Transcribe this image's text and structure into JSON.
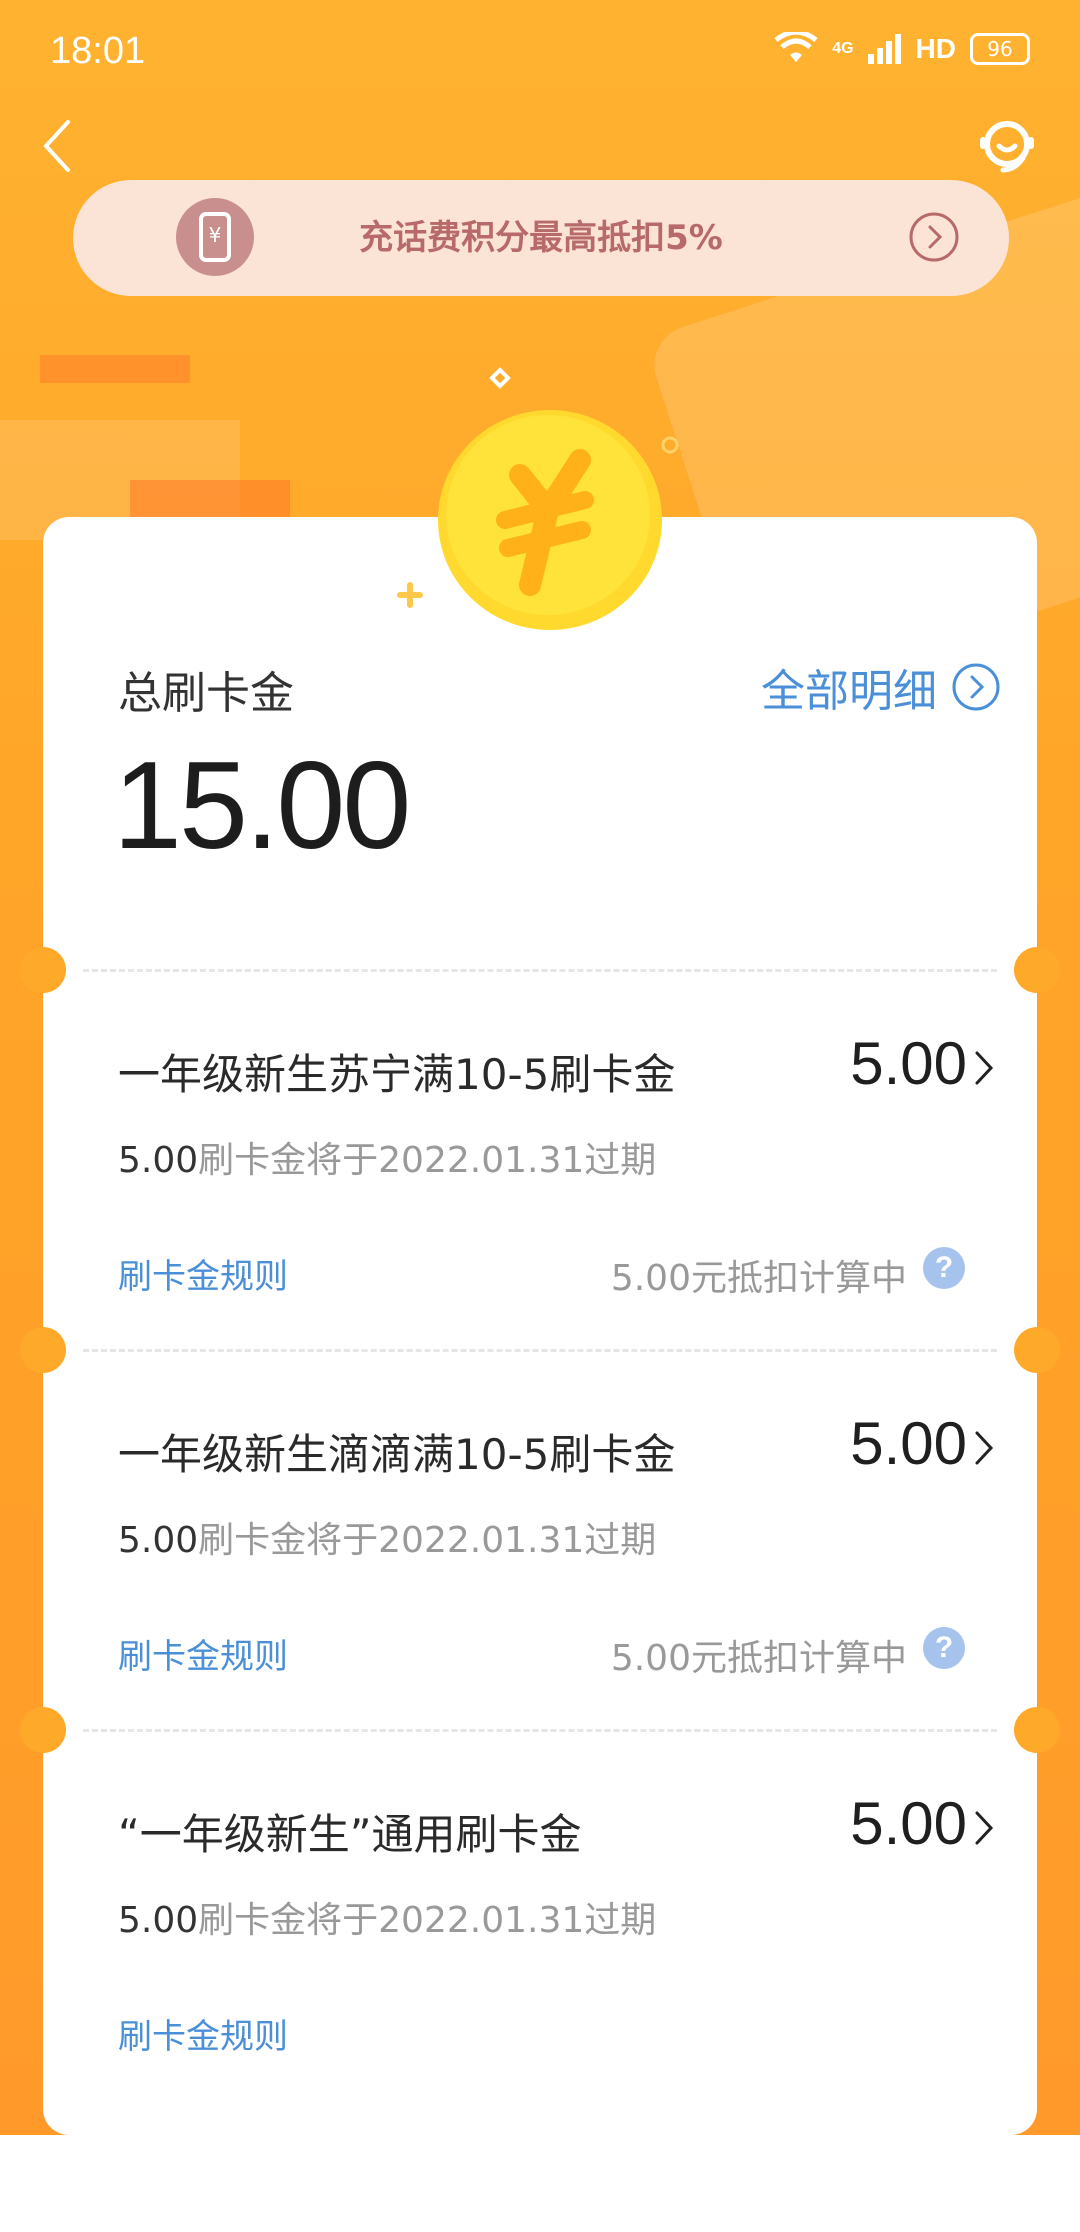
{
  "status_bar": {
    "time": "18:01",
    "network": "4G",
    "hd": "HD",
    "battery": "96"
  },
  "banner": {
    "text": "充话费积分最高抵扣5%"
  },
  "summary": {
    "label": "总刷卡金",
    "amount": "15.00",
    "detail_link": "全部明细"
  },
  "items": [
    {
      "title": "一年级新生苏宁满10-5刷卡金",
      "amount": "5.00",
      "expire_amount": "5.00",
      "expire_text": "刷卡金将于2022.01.31过期",
      "rule": "刷卡金规则",
      "status": "5.00元抵扣计算中"
    },
    {
      "title": "一年级新生滴滴满10-5刷卡金",
      "amount": "5.00",
      "expire_amount": "5.00",
      "expire_text": "刷卡金将于2022.01.31过期",
      "rule": "刷卡金规则",
      "status": "5.00元抵扣计算中"
    },
    {
      "title": "“一年级新生”通用刷卡金",
      "amount": "5.00",
      "expire_amount": "5.00",
      "expire_text": "刷卡金将于2022.01.31过期",
      "rule": "刷卡金规则",
      "status": ""
    }
  ],
  "icons": {
    "back": "back-arrow-icon",
    "support": "customer-service-icon",
    "banner": "phone-yuan-icon",
    "coin": "yuan-coin-icon",
    "help": "question-icon"
  },
  "colors": {
    "accent": "#4a8fd8",
    "background": "#ffa92a",
    "banner_text": "#b8696a"
  }
}
